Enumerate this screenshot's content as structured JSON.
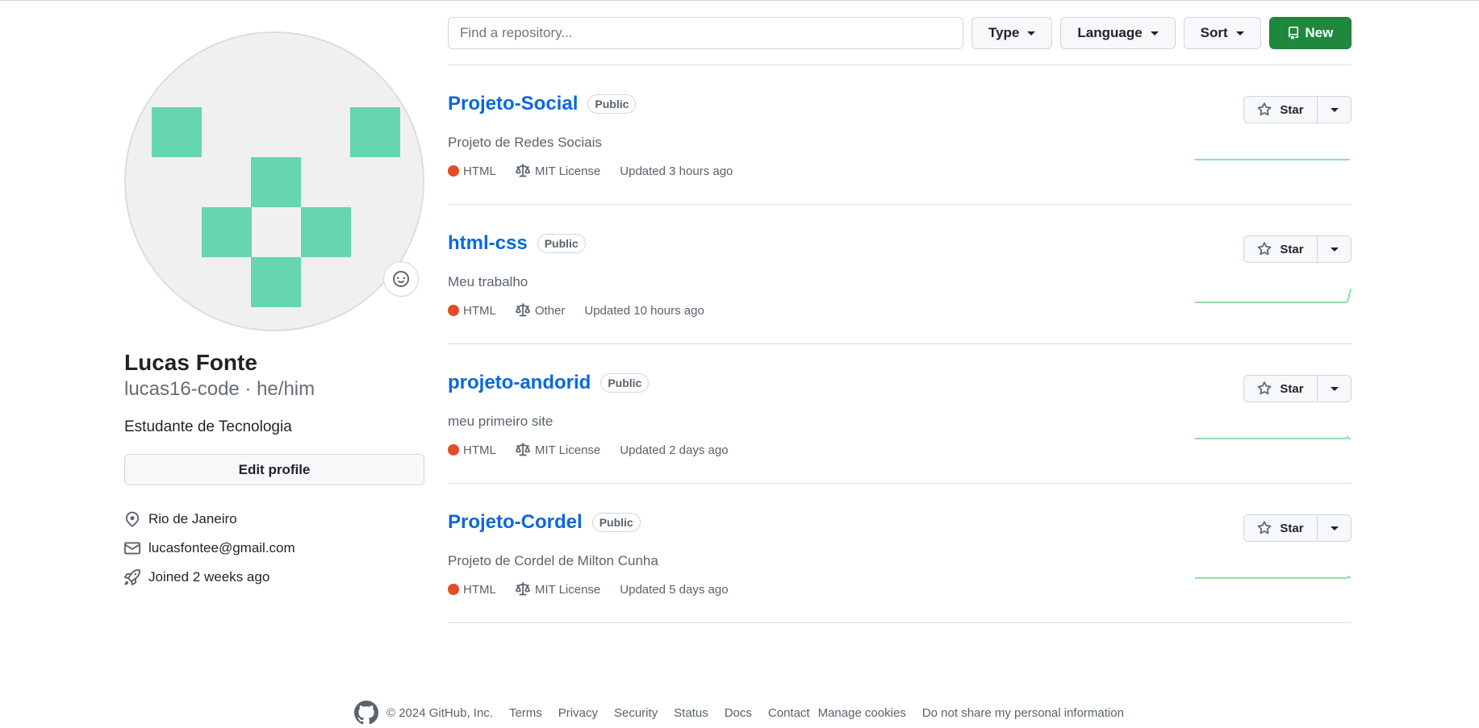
{
  "profile": {
    "name": "Lucas Fonte",
    "username_line": "lucas16-code · he/him",
    "bio": "Estudante de Tecnologia",
    "edit_label": "Edit profile",
    "location": "Rio de Janeiro",
    "email": "lucasfontee@gmail.com",
    "joined": "Joined 2 weeks ago",
    "avatar_color": "#66d6ae"
  },
  "toolbar": {
    "search_placeholder": "Find a repository...",
    "type_label": "Type",
    "language_label": "Language",
    "sort_label": "Sort",
    "new_label": "New"
  },
  "repos": [
    {
      "name": "Projeto-Social",
      "visibility": "Public",
      "description": "Projeto de Redes Sociais",
      "language": "HTML",
      "license": "MIT License",
      "updated": "Updated 3 hours ago",
      "star_label": "Star"
    },
    {
      "name": "html-css",
      "visibility": "Public",
      "description": "Meu trabalho",
      "language": "HTML",
      "license": "Other",
      "updated": "Updated 10 hours ago",
      "star_label": "Star"
    },
    {
      "name": "projeto-andorid",
      "visibility": "Public",
      "description": "meu primeiro site",
      "language": "HTML",
      "license": "MIT License",
      "updated": "Updated 2 days ago",
      "star_label": "Star"
    },
    {
      "name": "Projeto-Cordel",
      "visibility": "Public",
      "description": "Projeto de Cordel de Milton Cunha",
      "language": "HTML",
      "license": "MIT License",
      "updated": "Updated 5 days ago",
      "star_label": "Star"
    }
  ],
  "footer": {
    "copyright": "© 2024 GitHub, Inc.",
    "links": [
      "Terms",
      "Privacy",
      "Security",
      "Status",
      "Docs",
      "Contact",
      "Manage cookies",
      "Do not share my personal information"
    ]
  },
  "colors": {
    "accent_link": "#0969da",
    "new_button": "#1f883d",
    "html_lang": "#e34c26",
    "sparkline": "#8ee0a8"
  }
}
